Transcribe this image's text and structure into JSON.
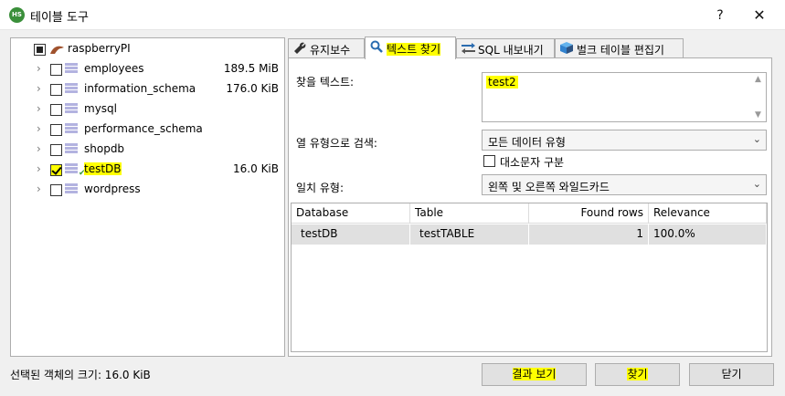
{
  "window": {
    "title": "테이블 도구",
    "app_icon_text": "HS",
    "help": "?",
    "close": "✕"
  },
  "tree": {
    "root": {
      "label": "raspberryPI"
    },
    "items": [
      {
        "label": "employees",
        "size": "189.5 MiB",
        "checked": false
      },
      {
        "label": "information_schema",
        "size": "176.0 KiB",
        "checked": false
      },
      {
        "label": "mysql",
        "size": "",
        "checked": false
      },
      {
        "label": "performance_schema",
        "size": "",
        "checked": false
      },
      {
        "label": "shopdb",
        "size": "",
        "checked": false
      },
      {
        "label": "testDB",
        "size": "16.0 KiB",
        "checked": true
      },
      {
        "label": "wordpress",
        "size": "",
        "checked": false
      }
    ]
  },
  "status": {
    "text": "선택된 객체의 크기: 16.0 KiB"
  },
  "tabs": [
    {
      "label": "유지보수",
      "icon": "wrench-icon"
    },
    {
      "label": "텍스트 찾기",
      "icon": "search-icon"
    },
    {
      "label": "SQL 내보내기",
      "icon": "export-icon"
    },
    {
      "label": "벌크 테이블 편집기",
      "icon": "cube-icon"
    }
  ],
  "find": {
    "text_label": "찾을 텍스트:",
    "text_value": "test2",
    "column_type_label": "열 유형으로 검색:",
    "column_type_value": "모든 데이터 유형",
    "case_label": "대소문자 구분",
    "match_label": "일치 유형:",
    "match_value": "왼쪽 및 오른쪽 와일드카드"
  },
  "results": {
    "columns": [
      "Database",
      "Table",
      "Found rows",
      "Relevance"
    ],
    "rows": [
      [
        "testDB",
        "testTABLE",
        "1",
        "100.0%"
      ]
    ]
  },
  "buttons": {
    "results": "결과 보기",
    "find": "찾기",
    "close": "닫기"
  },
  "colors": {
    "highlight": "#ffff00",
    "grid_row": "#e0e0e0"
  }
}
